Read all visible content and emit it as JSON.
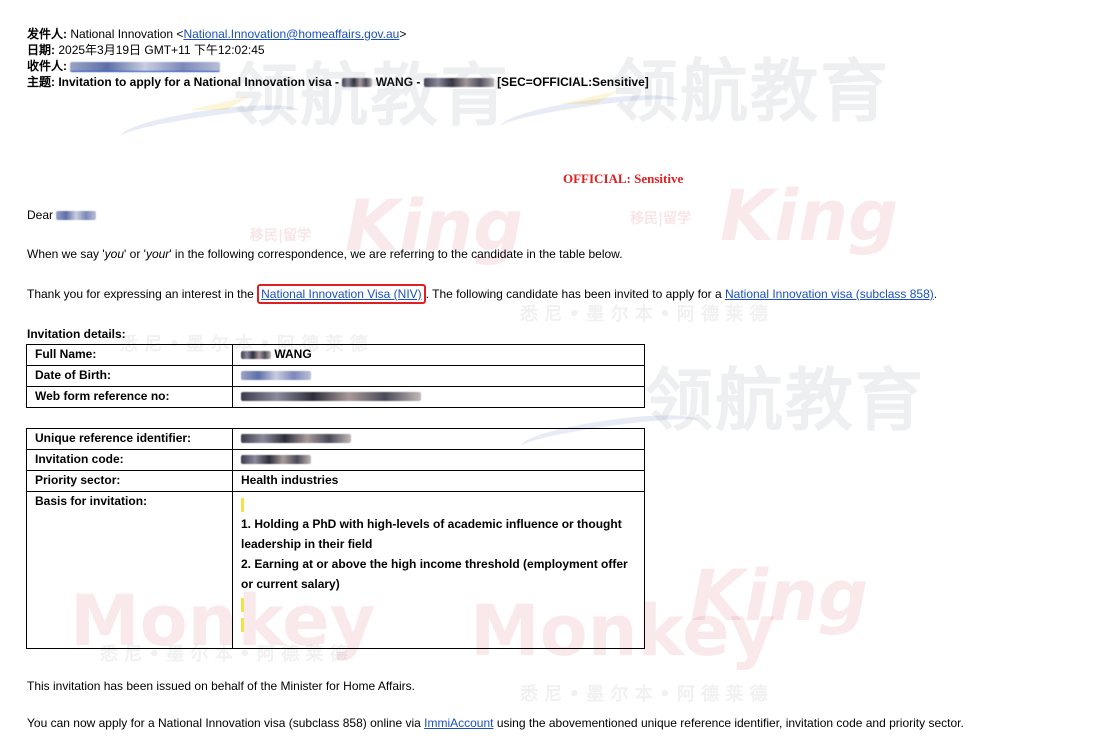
{
  "email": {
    "from_label": "发件人:",
    "from_name": "National Innovation <",
    "from_email": "National.Innovation@homeaffairs.gov.au",
    "from_close": ">",
    "date_label": "日期:",
    "date_value": "2025年3月19日 GMT+11 下午12:02:45",
    "to_label": "收件人:",
    "subject_label": "主题:",
    "subject_prefix": "Invitation to apply for a National Innovation visa - ",
    "subject_name": "WANG - ",
    "subject_suffix": "[SEC=OFFICIAL:Sensitive]"
  },
  "body": {
    "classification": "OFFICIAL: Sensitive",
    "greeting": "Dear",
    "para1_a": "When we say '",
    "para1_you": "you",
    "para1_b": "' or '",
    "para1_your": "your",
    "para1_c": "' in the following correspondence, we are referring to the candidate in the table below.",
    "para2_a": "Thank you for expressing an interest in the ",
    "para2_link1": "National Innovation Visa (NIV)",
    "para2_b": ". The following candidate has been invited to apply for a ",
    "para2_link2": "National Innovation visa (subclass 858)",
    "para2_c": ".",
    "invitation_heading": "Invitation details:",
    "footer1": "This invitation has been issued on behalf of the Minister for Home Affairs.",
    "footer2_a": "You can now apply for a National Innovation visa (subclass 858) online via ",
    "footer2_link": "ImmiAccount",
    "footer2_b": " using the abovementioned unique reference identifier, invitation code and priority sector."
  },
  "table1": {
    "full_name_label": "Full Name:",
    "full_name_value": "WANG",
    "dob_label": "Date of Birth:",
    "webform_label": "Web form reference no:"
  },
  "table2": {
    "uri_label": "Unique reference identifier:",
    "code_label": "Invitation code:",
    "sector_label": "Priority sector:",
    "sector_value": "Health industries",
    "basis_label": "Basis for invitation:",
    "basis_1": "1. Holding a PhD with high-levels of academic influence or thought leadership in their field",
    "basis_2": "2. Earning at or above the high income threshold (employment offer or current salary)"
  },
  "watermark": {
    "cn": "领航教育",
    "king": "King",
    "monkey": "Monkey",
    "small_cn": "移民|留学",
    "gray_cn": "悉 尼 • 墨 尔 本 • 阿 德 莱 德"
  }
}
